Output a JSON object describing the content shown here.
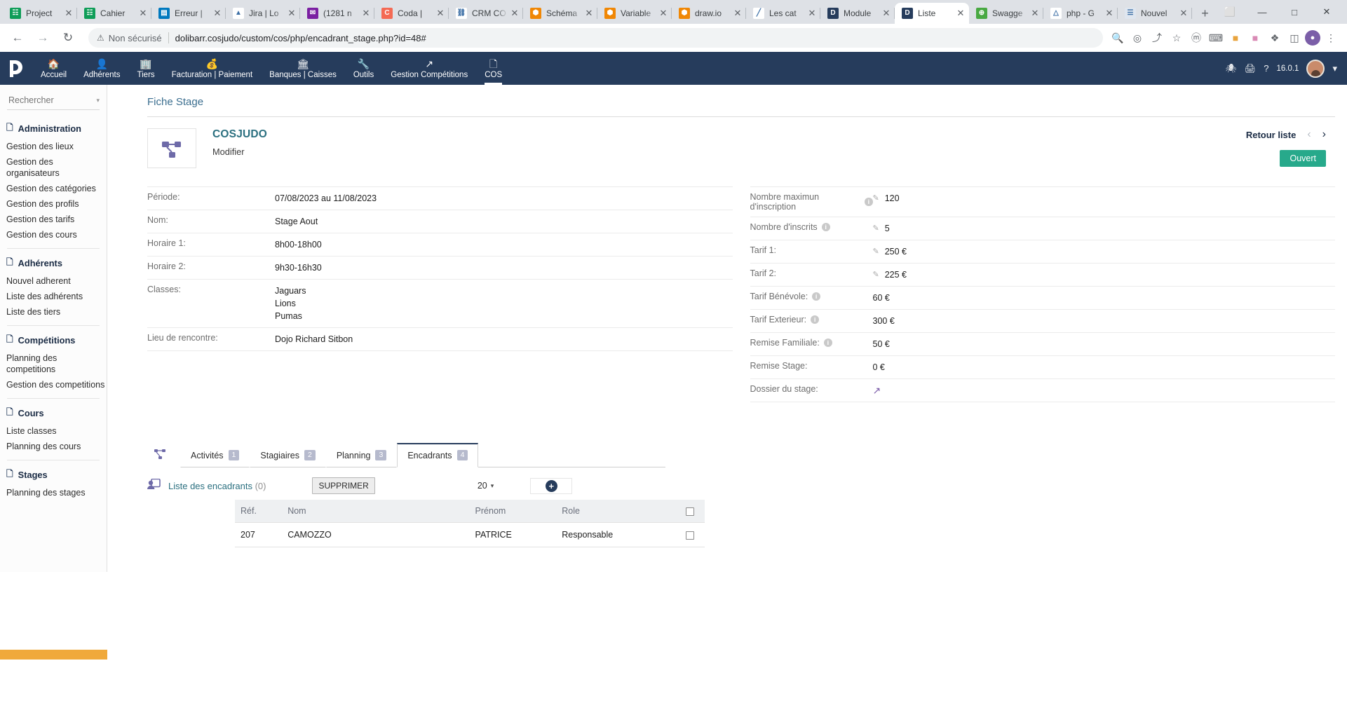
{
  "browser": {
    "tabs": [
      {
        "title": "Project",
        "favicon": "sheets-icon",
        "color": "#0f9d58",
        "glyph": "☷"
      },
      {
        "title": "Cahier ",
        "favicon": "sheets-icon",
        "color": "#0f9d58",
        "glyph": "☷"
      },
      {
        "title": "Erreur |",
        "favicon": "trello-icon",
        "color": "#0079bf",
        "glyph": "▤"
      },
      {
        "title": "Jira | Lo",
        "favicon": "jira-icon",
        "color": "#ffffff",
        "glyph": "▲"
      },
      {
        "title": "(1281 n",
        "favicon": "mail-icon",
        "color": "#7b1fa2",
        "glyph": "✉"
      },
      {
        "title": "Coda | ",
        "favicon": "coda-icon",
        "color": "#f46a54",
        "glyph": "C"
      },
      {
        "title": "CRM CO",
        "favicon": "lucidchart-icon",
        "color": "#ffffff",
        "glyph": "⛓"
      },
      {
        "title": "Schéma",
        "favicon": "drawio-icon",
        "color": "#f08705",
        "glyph": "⬢"
      },
      {
        "title": "Variable",
        "favicon": "drawio-icon",
        "color": "#f08705",
        "glyph": "⬢"
      },
      {
        "title": "draw.io",
        "favicon": "drawio-icon",
        "color": "#f08705",
        "glyph": "⬢"
      },
      {
        "title": "Les cat",
        "favicon": "pen-icon",
        "color": "#ffffff",
        "glyph": "╱"
      },
      {
        "title": "Module",
        "favicon": "dolibarr-icon",
        "color": "#263c5c",
        "glyph": "D"
      },
      {
        "title": "Liste",
        "favicon": "dolibarr-icon",
        "color": "#263c5c",
        "glyph": "D",
        "active": true
      },
      {
        "title": "Swagge",
        "favicon": "swagger-icon",
        "color": "#49a942",
        "glyph": "⊕"
      },
      {
        "title": "php - G",
        "favicon": "drive-icon",
        "color": "#ffffff",
        "glyph": "△"
      },
      {
        "title": "Nouvel",
        "favicon": "notepad-icon",
        "color": "#dfe6ef",
        "glyph": "☰"
      }
    ],
    "new_tab_label": "+",
    "window_minimize": "—",
    "window_maximize": "□",
    "window_close": "✕",
    "window_restore": "⬜",
    "nav": {
      "back": "←",
      "forward": "→",
      "reload": "↻"
    },
    "omnibox": {
      "warning_icon": "⚠",
      "security_label": "Non sécurisé",
      "url": "dolibarr.cosjudo/custom/cos/php/encadrant_stage.php?id=48#"
    },
    "toolbar_icons": [
      {
        "name": "zoom-icon",
        "glyph": "🔍"
      },
      {
        "name": "location-icon",
        "glyph": "◎"
      },
      {
        "name": "share-icon",
        "glyph": "⤴"
      },
      {
        "name": "bookmark-star-icon",
        "glyph": "☆"
      },
      {
        "name": "vpn-icon",
        "glyph": "ⓜ"
      },
      {
        "name": "translate-icon",
        "glyph": "⌨"
      },
      {
        "name": "extension-orange-icon",
        "glyph": "■"
      },
      {
        "name": "extension-pink-icon",
        "glyph": "■"
      },
      {
        "name": "puzzle-icon",
        "glyph": "❖"
      },
      {
        "name": "sidepanel-icon",
        "glyph": "◫"
      },
      {
        "name": "profile-avatar",
        "glyph": "●"
      },
      {
        "name": "chrome-menu-icon",
        "glyph": "⋮"
      }
    ]
  },
  "topmenu": {
    "logo": "D",
    "items": [
      {
        "label": "Accueil",
        "icon": "home-icon",
        "glyph": "🏠"
      },
      {
        "label": "Adhérents",
        "icon": "user-icon",
        "glyph": "👤"
      },
      {
        "label": "Tiers",
        "icon": "building-icon",
        "glyph": "🏢"
      },
      {
        "label": "Facturation | Paiement",
        "icon": "coins-icon",
        "glyph": "💰"
      },
      {
        "label": "Banques | Caisses",
        "icon": "bank-icon",
        "glyph": "🏛"
      },
      {
        "label": "Outils",
        "icon": "wrench-icon",
        "glyph": "🔧"
      },
      {
        "label": "Gestion Compétitions",
        "icon": "external-icon",
        "glyph": "↗"
      },
      {
        "label": "COS",
        "icon": "page-icon",
        "glyph": "🗋",
        "active": true
      }
    ],
    "right": {
      "icons": [
        {
          "name": "bug-icon",
          "glyph": "🕷"
        },
        {
          "name": "print-icon",
          "glyph": "🖨"
        },
        {
          "name": "help-icon",
          "glyph": "?"
        }
      ],
      "version": "16.0.1",
      "user_caret": "▾"
    }
  },
  "sidebar": {
    "search_placeholder": "Rechercher",
    "search_value": "",
    "caret": "▾",
    "groups": [
      {
        "title": "Administration",
        "links": [
          "Gestion des lieux",
          "Gestion des organisateurs",
          "Gestion des catégories",
          "Gestion des profils",
          "Gestion des tarifs",
          "Gestion des cours"
        ]
      },
      {
        "title": "Adhérents",
        "links": [
          "Nouvel adherent",
          "Liste des adhérents",
          "Liste des tiers"
        ]
      },
      {
        "title": "Compétitions",
        "links": [
          "Planning des competitions",
          "Gestion des competitions"
        ]
      },
      {
        "title": "Cours",
        "links": [
          "Liste classes",
          "Planning des cours"
        ]
      },
      {
        "title": "Stages",
        "links": [
          "Planning des stages"
        ]
      }
    ]
  },
  "main": {
    "page_title": "Fiche Stage",
    "object": {
      "name": "COSJUDO",
      "sub_link": "Modifier",
      "logo_icon": "sitemap-icon"
    },
    "header_actions": {
      "back_to_list": "Retour liste",
      "prev": "‹",
      "next": "›",
      "status_badge": "Ouvert"
    },
    "left_fields": [
      {
        "label": "Période:",
        "value": "07/08/2023 au 11/08/2023"
      },
      {
        "label": "Nom:",
        "value": "Stage Aout"
      },
      {
        "label": "Horaire 1:",
        "value": "8h00-18h00"
      },
      {
        "label": "Horaire 2:",
        "value": "9h30-16h30"
      },
      {
        "label": "Classes:",
        "values": [
          "Jaguars",
          "Lions",
          "Pumas"
        ]
      },
      {
        "label": "Lieu de rencontre:",
        "value": "Dojo Richard Sitbon"
      }
    ],
    "right_fields": [
      {
        "label": "Nombre maximun d'inscription",
        "info": true,
        "pencil": true,
        "value": "120"
      },
      {
        "label": "Nombre d'inscrits",
        "info": true,
        "pencil": true,
        "value": "5"
      },
      {
        "label": "Tarif 1:",
        "info": false,
        "pencil": true,
        "value": "250 €"
      },
      {
        "label": "Tarif 2:",
        "info": false,
        "pencil": true,
        "value": "225 €"
      },
      {
        "label": "Tarif Bénévole:",
        "info": true,
        "pencil": false,
        "value": "60 €"
      },
      {
        "label": "Tarif Exterieur:",
        "info": true,
        "pencil": false,
        "value": "300 €"
      },
      {
        "label": "Remise Familiale:",
        "info": true,
        "pencil": false,
        "value": "50 €"
      },
      {
        "label": "Remise Stage:",
        "info": false,
        "pencil": false,
        "value": "0 €"
      },
      {
        "label": "Dossier du stage:",
        "info": false,
        "pencil": false,
        "value": "",
        "link_icon": "↗"
      }
    ],
    "tabs": [
      {
        "label": "Activités",
        "count": "1"
      },
      {
        "label": "Stagiaires",
        "count": "2"
      },
      {
        "label": "Planning",
        "count": "3"
      },
      {
        "label": "Encadrants",
        "count": "4",
        "active": true
      }
    ],
    "list": {
      "title": "Liste des encadrants",
      "count_suffix": "(0)",
      "delete_button": "SUPPRIMER",
      "per_page": "20",
      "per_page_caret": "▾",
      "add_button": "+",
      "columns": [
        "Réf.",
        "Nom",
        "Prénom",
        "Role",
        ""
      ],
      "rows": [
        {
          "ref": "207",
          "nom": "CAMOZZO",
          "prenom": "PATRICE",
          "role": "Responsable"
        }
      ]
    }
  },
  "colors": {
    "brand_navy": "#263c5c",
    "teal_link": "#2a6f7f",
    "status_green": "#27a98b",
    "purple_icon": "#6e6aa8",
    "orange_strip": "#f0a93b"
  }
}
